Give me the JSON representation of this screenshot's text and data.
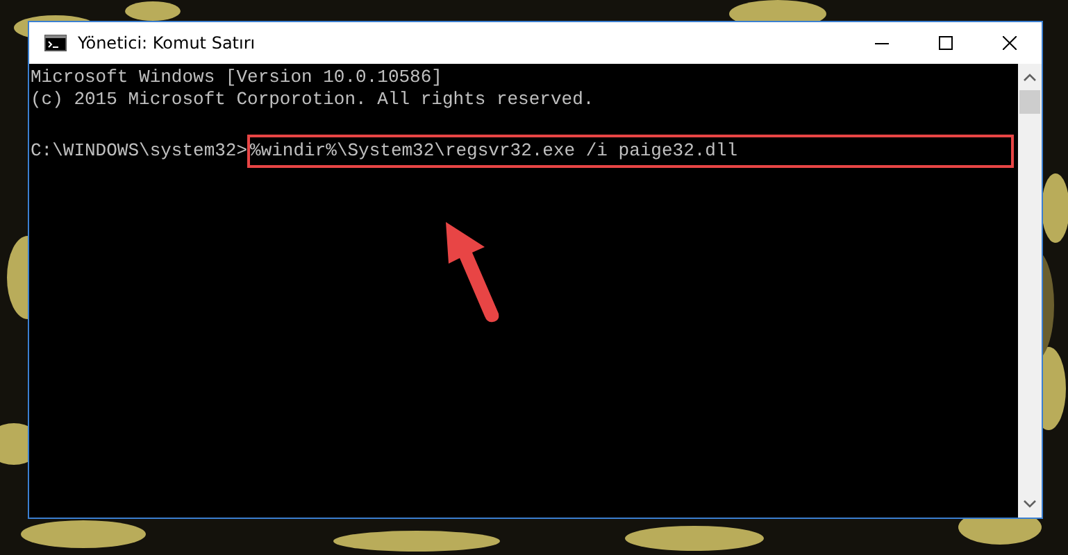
{
  "window": {
    "title": "Yönetici: Komut Satırı"
  },
  "console": {
    "lines": [
      {
        "kind": "output",
        "text": "Microsoft Windows [Version 10.0.10586]"
      },
      {
        "kind": "output",
        "text": "(c) 2015 Microsoft Corporotion. All rights reserved."
      },
      {
        "kind": "blank"
      },
      {
        "kind": "command",
        "prompt": "C:\\WINDOWS\\system32>",
        "command": "%windir%\\System32\\regsvr32.exe /i paige32.dll",
        "highlighted": true
      }
    ]
  }
}
